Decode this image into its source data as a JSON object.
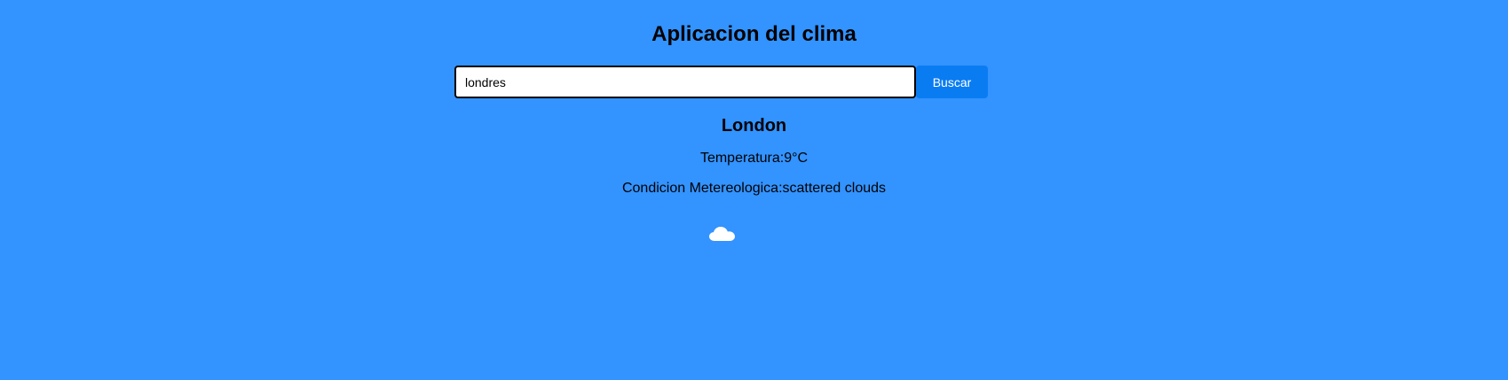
{
  "app": {
    "title": "Aplicacion del clima"
  },
  "search": {
    "value": "londres",
    "button_label": "Buscar"
  },
  "weather": {
    "city": "London",
    "temperature_text": "Temperatura:9°C",
    "condition_text": "Condicion Metereologica:scattered clouds",
    "icon": "cloud-icon"
  },
  "colors": {
    "background": "#3393ff",
    "button": "#0a7cf2",
    "icon": "#ffffff"
  }
}
